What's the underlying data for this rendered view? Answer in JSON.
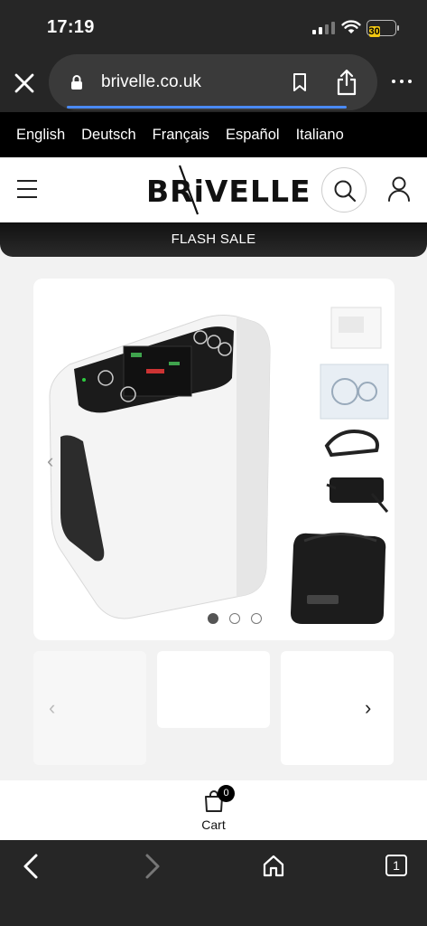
{
  "status": {
    "time": "17:19",
    "battery": "30"
  },
  "browser": {
    "url": "brivelle.co.uk"
  },
  "languages": [
    "English",
    "Deutsch",
    "Français",
    "Español",
    "Italiano"
  ],
  "header": {
    "logo": "BRiVELLE"
  },
  "flash": {
    "label": "FLASH SALE"
  },
  "carousel": {
    "slides": 3,
    "active": 0
  },
  "cart": {
    "label": "Cart",
    "count": "0"
  },
  "toolbar": {
    "tabs_count": "1"
  }
}
